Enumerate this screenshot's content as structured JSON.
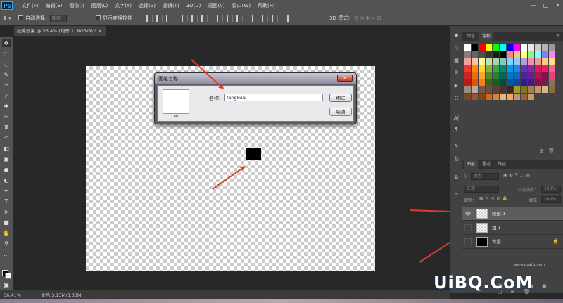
{
  "app": {
    "logo": "Ps"
  },
  "menu": [
    "文件(F)",
    "编辑(E)",
    "图像(I)",
    "图层(L)",
    "文字(Y)",
    "选择(S)",
    "滤镜(T)",
    "3D(D)",
    "视图(V)",
    "窗口(W)",
    "帮助(H)"
  ],
  "window_controls": [
    "—",
    "▢",
    "✕"
  ],
  "options": {
    "auto_select_label": "自动选择：",
    "auto_select_value": "图层",
    "show_transform_label": "显示变换控件",
    "mode_3d_label": "3D 模式："
  },
  "document": {
    "tab_title": "故障效果 @ 56.4% (矩形 1, RGB/8) *",
    "zoom": "56.41%",
    "doc_info": "文档:3.13M/3.33M"
  },
  "dialog": {
    "title": "画笔名称",
    "close": "✕",
    "preview_number": "60",
    "name_label": "名称:",
    "name_value": "fangkuai",
    "ok": "确定",
    "cancel": "取消"
  },
  "panels": {
    "top_tabs": [
      "颜色",
      "色板"
    ],
    "layer_tabs": [
      "图层",
      "通道",
      "路径"
    ],
    "filter_label": "类型",
    "blend_mode": "正常",
    "opacity_label": "不透明度：",
    "opacity_value": "100%",
    "lock_label": "锁定：",
    "fill_label": "填充：",
    "fill_value": "100%"
  },
  "layers": [
    {
      "name": "矩形 1",
      "visible": true,
      "selected": true,
      "thumb": "checker"
    },
    {
      "name": "组 1",
      "visible": false,
      "selected": false,
      "thumb": "checker"
    },
    {
      "name": "背景",
      "visible": false,
      "selected": false,
      "thumb": "black",
      "locked": true
    }
  ],
  "swatch_colors": [
    "#ffffff",
    "#000000",
    "#ff0000",
    "#ffff00",
    "#00ff00",
    "#00ffff",
    "#0000ff",
    "#ff00ff",
    "#ffffff",
    "#e6e6e6",
    "#cccccc",
    "#b3b3b3",
    "#999999",
    "#808080",
    "#666666",
    "#4d4d4d",
    "#333333",
    "#1a1a1a",
    "#000000",
    "#ff8080",
    "#ffc080",
    "#ffff80",
    "#80ff80",
    "#80ffff",
    "#8080ff",
    "#ff80ff",
    "#f2a1a1",
    "#f7c59f",
    "#fff59d",
    "#c5e1a5",
    "#a5d6a7",
    "#80cbc4",
    "#81d4fa",
    "#90caf9",
    "#b39ddb",
    "#f48fb1",
    "#ef9a9a",
    "#ffcc80",
    "#ffe082",
    "#e53935",
    "#fb8c00",
    "#fdd835",
    "#7cb342",
    "#43a047",
    "#00897b",
    "#039be5",
    "#1e88e5",
    "#5e35b1",
    "#8e24aa",
    "#d81b60",
    "#e91e63",
    "#f06292",
    "#c62828",
    "#ef6c00",
    "#f9a825",
    "#558b2f",
    "#2e7d32",
    "#00695c",
    "#0277bd",
    "#1565c0",
    "#4527a0",
    "#6a1b9a",
    "#ad1457",
    "#880e4f",
    "#ec407a",
    "#b71c1c",
    "#e65100",
    "#f57f17",
    "#33691e",
    "#1b5e20",
    "#004d40",
    "#01579b",
    "#0d47a1",
    "#311b92",
    "#4a148c",
    "#880e4f",
    "#6d214f",
    "#8d6e63",
    "#a1887f",
    "#bcaaa4",
    "#795548",
    "#6d4c41",
    "#5d4037",
    "#4e342e",
    "#3e2723",
    "#9e9d24",
    "#827717",
    "#a57f5b",
    "#c49a6c",
    "#d7b98e",
    "#8a6d3b",
    "#6b4f2c",
    "#a0522d",
    "#8b4513",
    "#d2691e",
    "#cd853f",
    "#deb887",
    "#f4a460",
    "#bc8f8f",
    "#996633",
    "#cc9966"
  ],
  "watermark": {
    "text": "UiBQ.CoM",
    "small": "www.psahz.com"
  }
}
